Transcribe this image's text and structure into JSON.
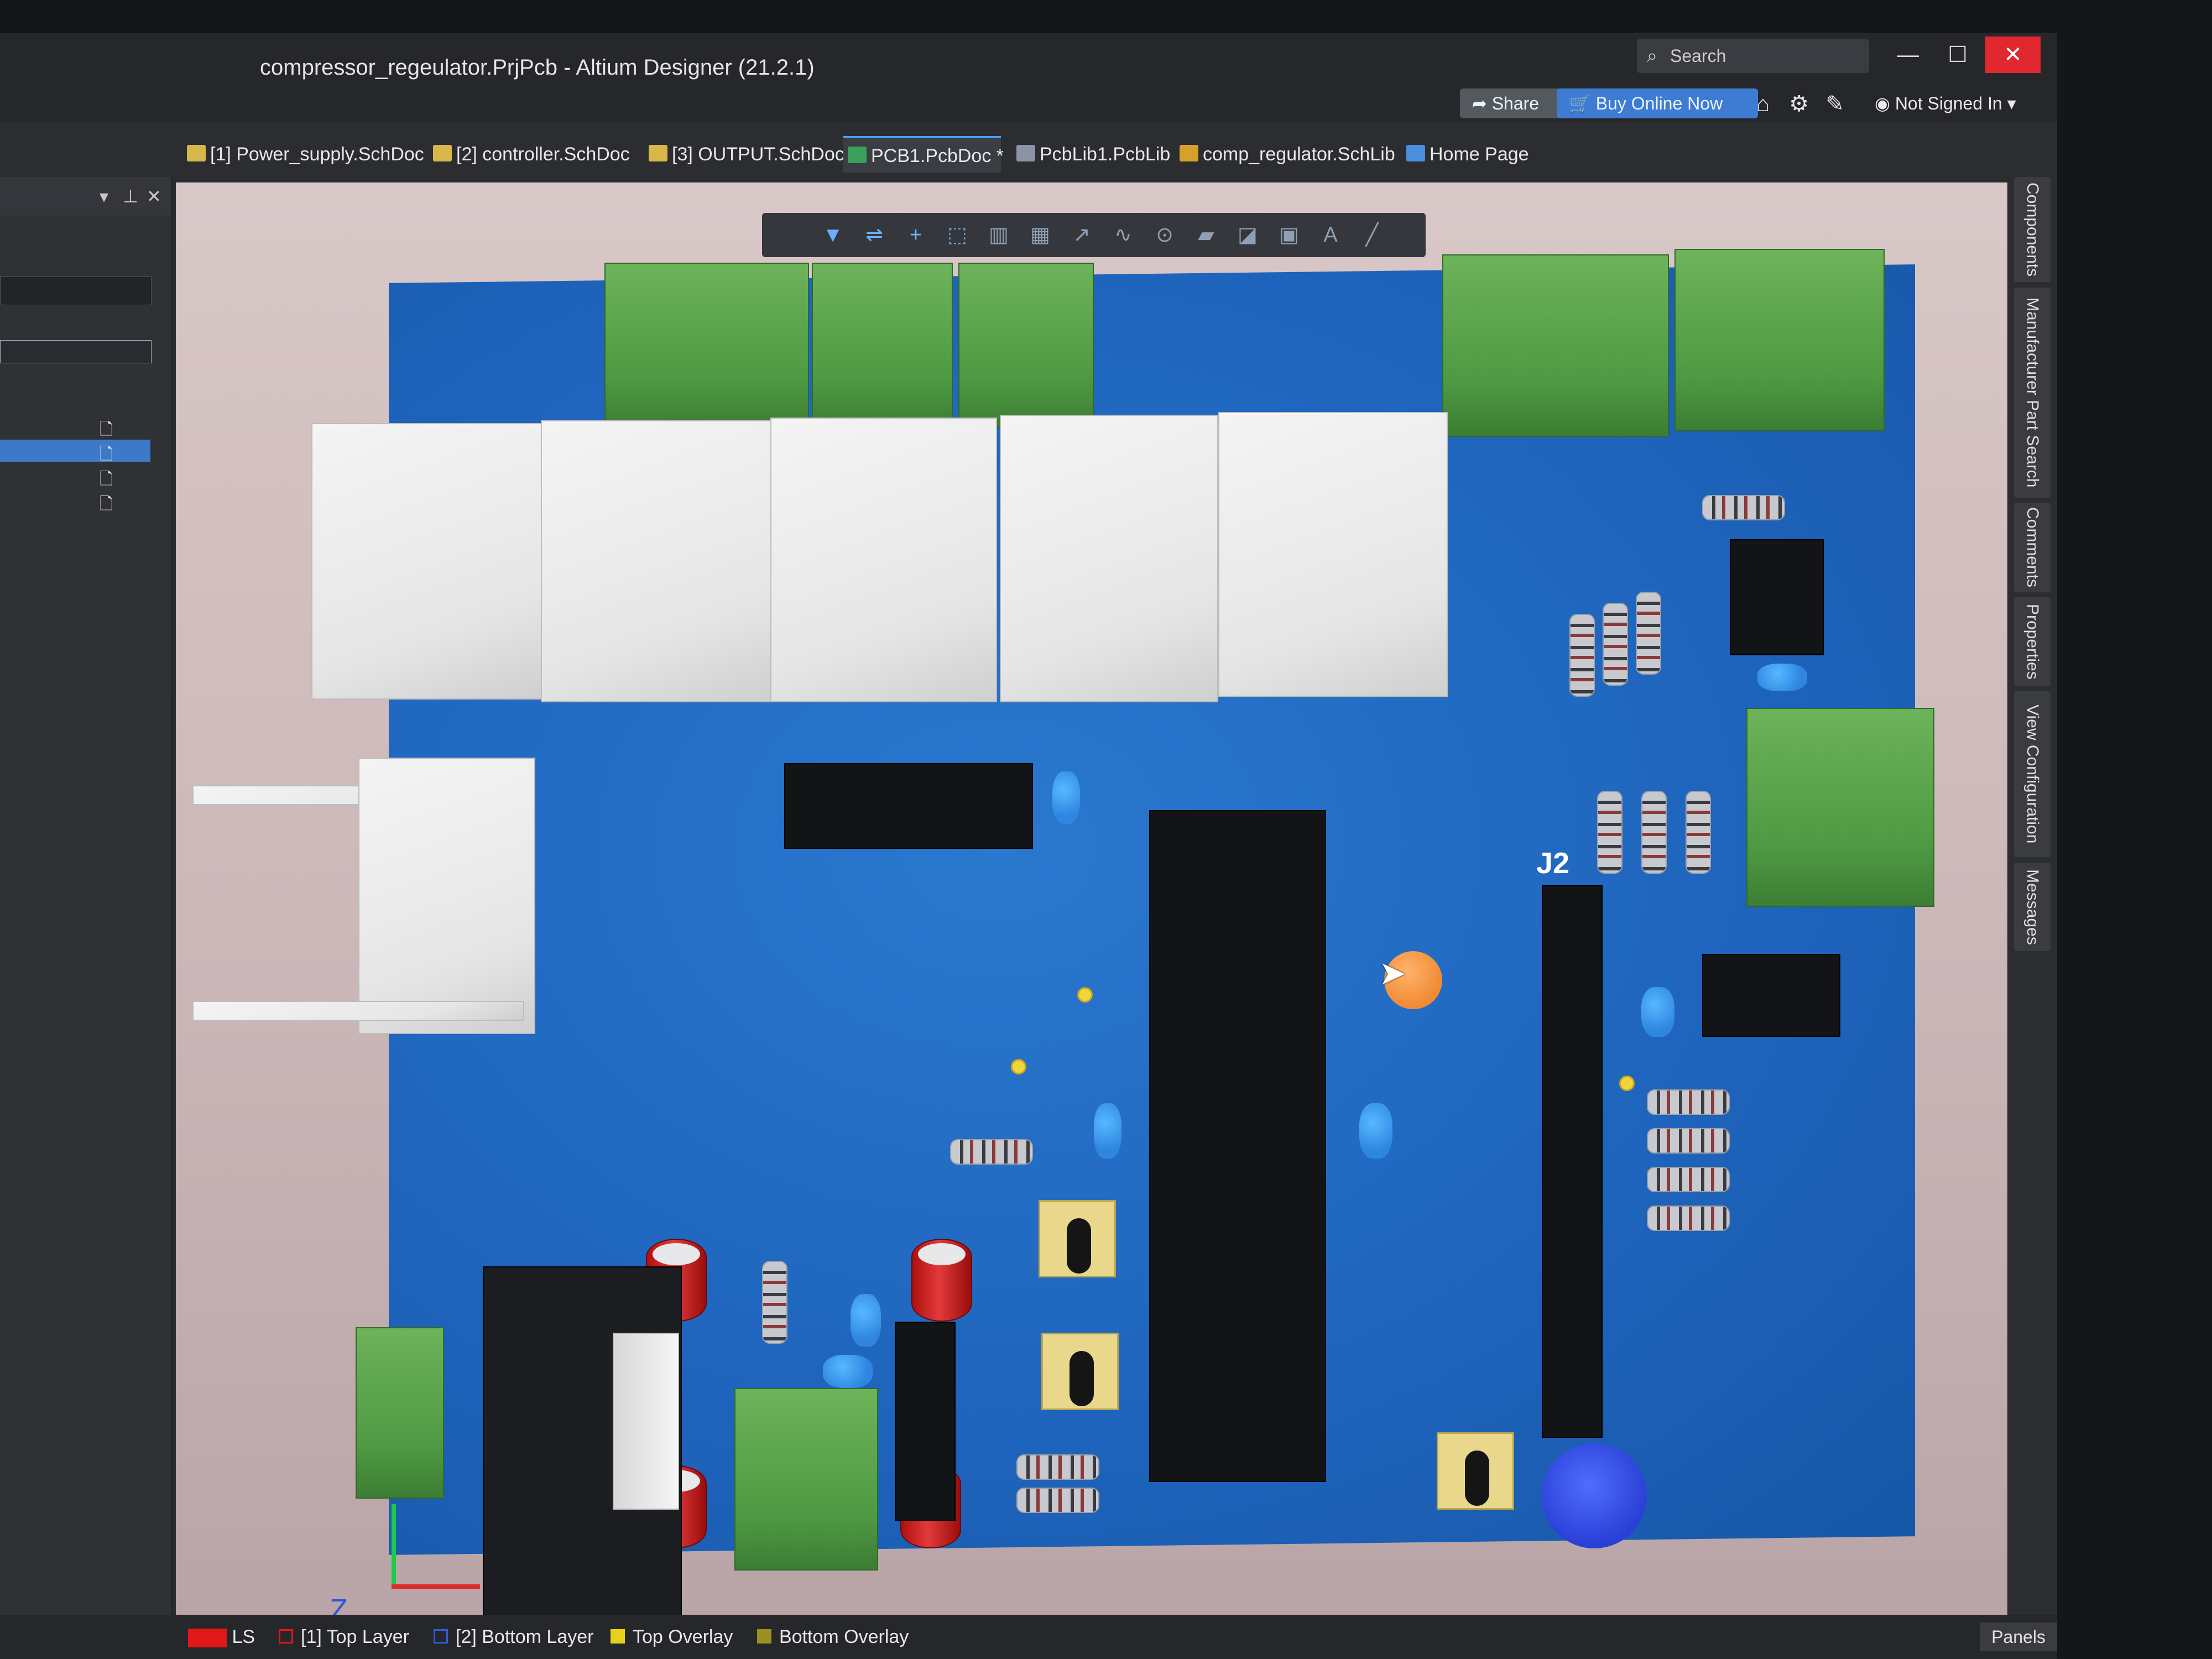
{
  "window": {
    "title": "compressor_regeulator.PrjPcb - Altium Designer (21.2.1)",
    "search_placeholder": "Search",
    "minimize": "—",
    "maximize": "☐",
    "close": "✕"
  },
  "toolbar": {
    "share_label": "Share",
    "buy_label": "Buy Online Now",
    "signed_label": "Not Signed In"
  },
  "tabs": [
    {
      "label": "[1] Power_supply.SchDoc",
      "active": false
    },
    {
      "label": "[2] controller.SchDoc",
      "active": false
    },
    {
      "label": "[3] OUTPUT.SchDoc",
      "active": false
    },
    {
      "label": "PCB1.PcbDoc *",
      "active": true
    },
    {
      "label": "PcbLib1.PcbLib",
      "active": false
    },
    {
      "label": "comp_regulator.SchLib",
      "active": false
    },
    {
      "label": "Home Page",
      "active": false
    }
  ],
  "right_panels": [
    "Components",
    "Manufacturer Part Search",
    "Comments",
    "Properties",
    "View Configuration",
    "Messages"
  ],
  "layers": [
    {
      "label": "LS",
      "color": "#e01818"
    },
    {
      "label": "[1] Top Layer",
      "color": "#e01818"
    },
    {
      "label": "[2] Bottom Layer",
      "color": "#2f5cd8"
    },
    {
      "label": "Top Overlay",
      "color": "#e6d21a"
    },
    {
      "label": "Bottom Overlay",
      "color": "#9a8f20"
    }
  ],
  "panels_button": "Panels",
  "pcb": {
    "designator_j2": "J2",
    "axis_z": "Z"
  },
  "colors": {
    "board": "#1f65be",
    "accent": "#3e7bd3"
  }
}
